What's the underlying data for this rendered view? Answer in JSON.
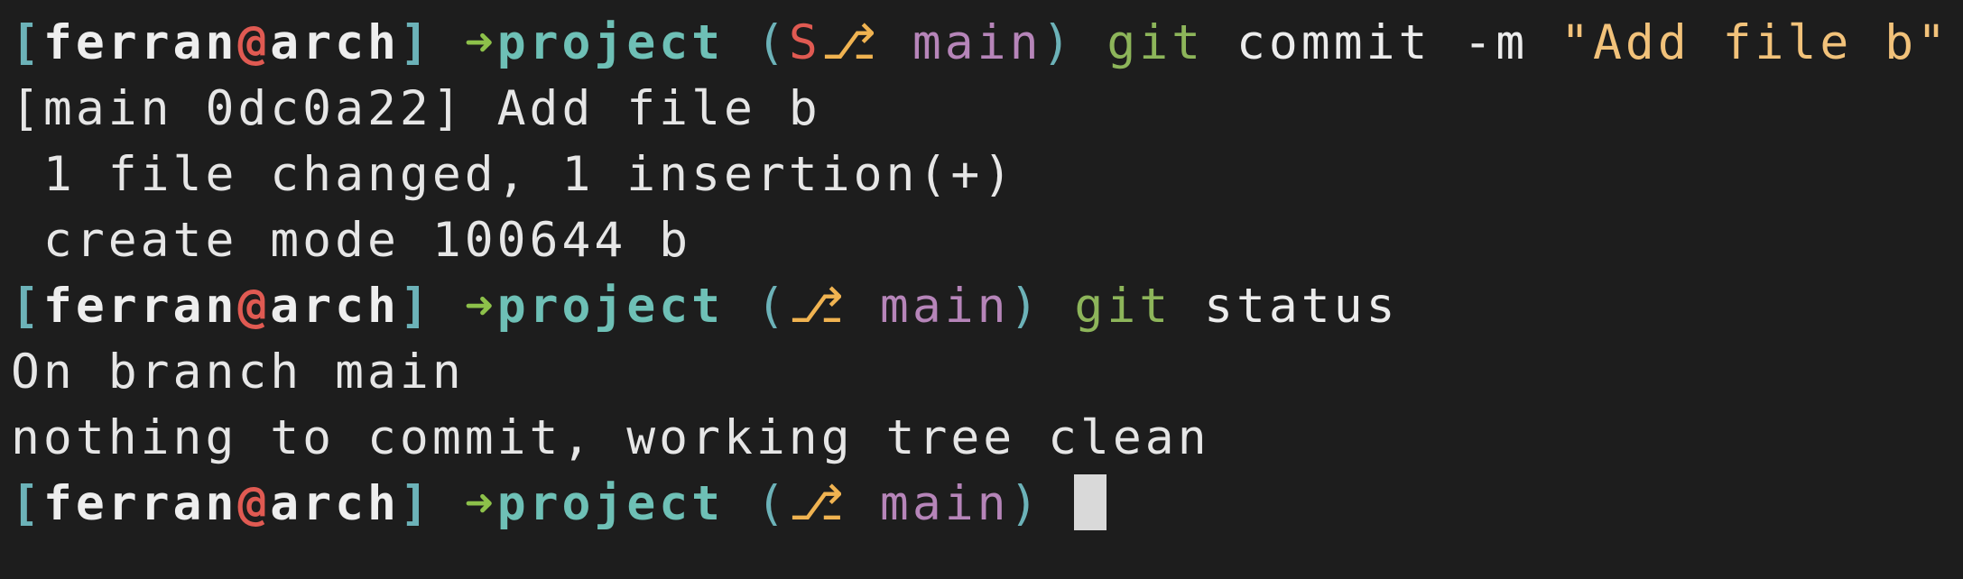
{
  "prompt": {
    "open_bracket": "[",
    "user": "ferran",
    "at": "@",
    "host": "arch",
    "close_bracket": "]",
    "arrow": "➜",
    "dir": "project",
    "paren_open": "(",
    "branch_icon": "⎇",
    "branch": "main",
    "paren_close": ")"
  },
  "colors": {
    "background": "#1d1d1d",
    "bracket": "#6cb2b8",
    "at": "#e05a52",
    "arrow": "#8dc14a",
    "dir": "#6ec0b6",
    "branch_icon": "#f0b351",
    "branch": "#b685b9",
    "git": "#8db55a",
    "string": "#f2c27a"
  },
  "lines": {
    "l1": {
      "staged": "S",
      "git": "git",
      "cmd": "commit -m",
      "str": "\"Add file b\""
    },
    "l2": "[main 0dc0a22] Add file b",
    "l3": " 1 file changed, 1 insertion(+)",
    "l4": " create mode 100644 b",
    "l5": {
      "git": "git",
      "cmd": "status"
    },
    "l6": "On branch main",
    "l7": "nothing to commit, working tree clean"
  }
}
